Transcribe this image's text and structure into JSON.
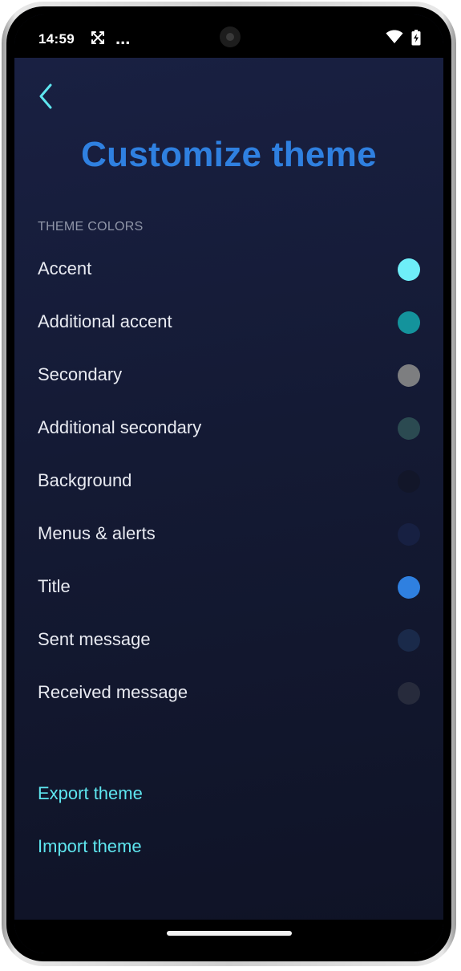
{
  "status_bar": {
    "time": "14:59",
    "app_icon": "crossed-arrows-icon",
    "more": "...",
    "icons": [
      "wifi-icon",
      "battery-charging-icon"
    ]
  },
  "header": {
    "back_icon": "chevron-left-icon",
    "title": "Customize theme"
  },
  "section": {
    "label": "THEME COLORS"
  },
  "colors": [
    {
      "label": "Accent",
      "color": "#6eeef8"
    },
    {
      "label": "Additional accent",
      "color": "#14939c"
    },
    {
      "label": "Secondary",
      "color": "#7d7e80"
    },
    {
      "label": "Additional secondary",
      "color": "#2b4a51"
    },
    {
      "label": "Background",
      "color": "#121629"
    },
    {
      "label": "Menus & alerts",
      "color": "#172042"
    },
    {
      "label": "Title",
      "color": "#2f80e0"
    },
    {
      "label": "Sent message",
      "color": "#1a2a4a"
    },
    {
      "label": "Received message",
      "color": "#272b3c"
    }
  ],
  "actions": {
    "export_label": "Export theme",
    "import_label": "Import theme"
  },
  "theme": {
    "accent": "#5ee6ef",
    "title": "#2f80e0",
    "background": "#151a33"
  }
}
